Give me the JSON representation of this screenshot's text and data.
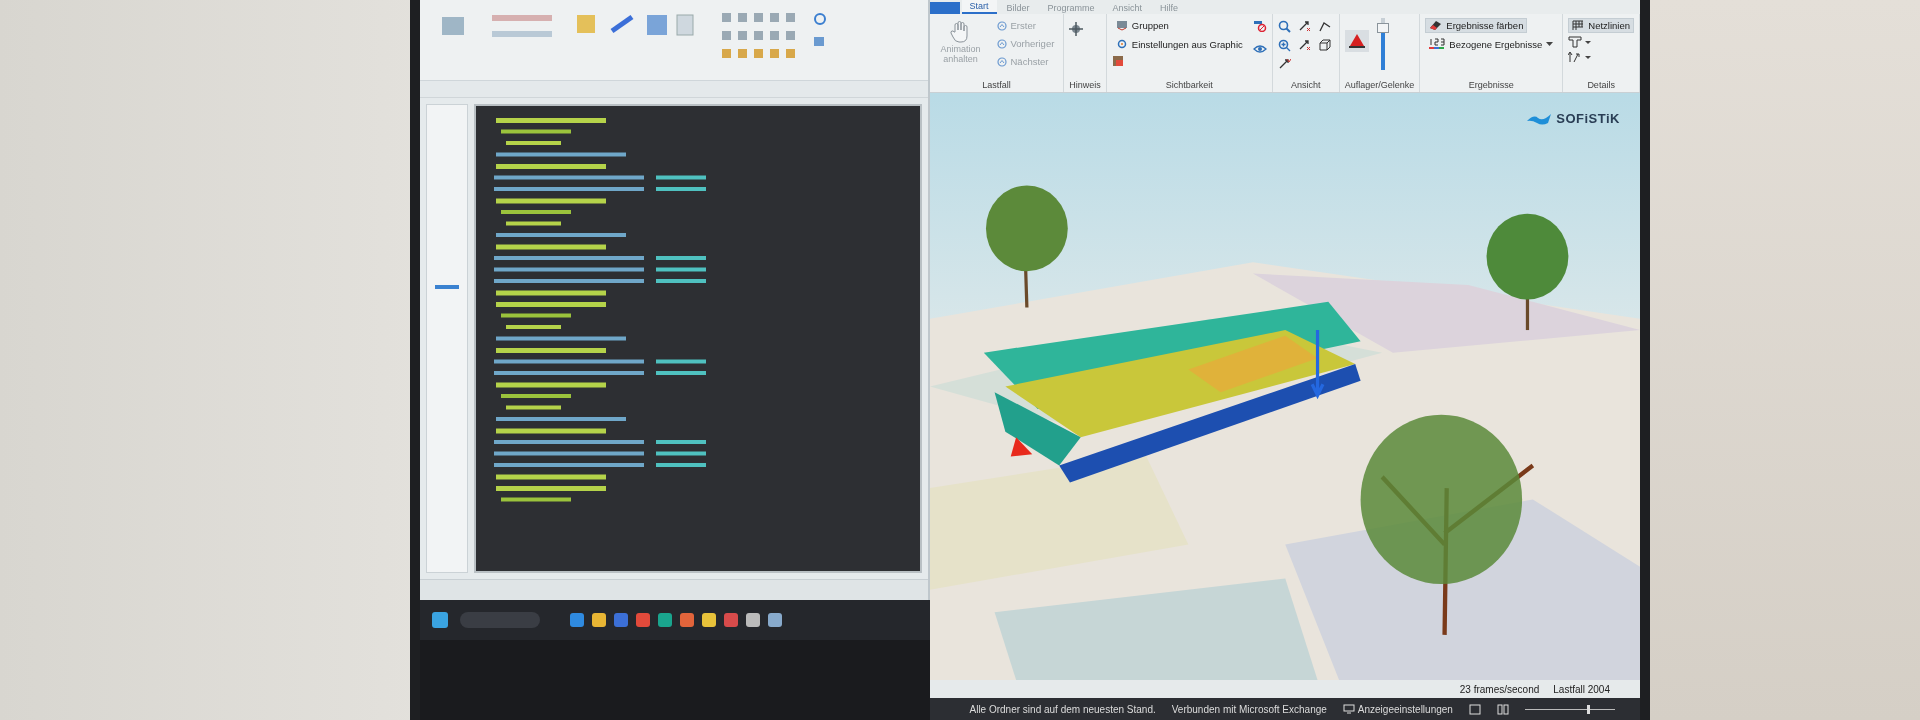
{
  "viewer": {
    "tabs": [
      {
        "label": "Start",
        "selected": true
      },
      {
        "label": "Bilder",
        "selected": false
      },
      {
        "label": "Programme",
        "selected": false
      },
      {
        "label": "Ansicht",
        "selected": false
      },
      {
        "label": "Hilfe",
        "selected": false
      }
    ],
    "groups": [
      {
        "title": "Lastfall",
        "kind": "lastfall",
        "large": {
          "label": "Animation anhalten",
          "disabled": true
        },
        "items": [
          {
            "label": "Erster",
            "disabled": true
          },
          {
            "label": "Vorheriger",
            "disabled": true
          },
          {
            "label": "Nächster",
            "disabled": true
          }
        ]
      },
      {
        "title": "Hinweis",
        "kind": "icon"
      },
      {
        "title": "Sichtbarkeit",
        "kind": "list",
        "items": [
          {
            "label": "Gruppen",
            "selected": false
          },
          {
            "label": "Einstellungen aus Graphic",
            "selected": false
          }
        ]
      },
      {
        "title": "Ansicht",
        "kind": "icons"
      },
      {
        "title": "Auflager/Gelenke",
        "kind": "slider",
        "level": 0.8
      },
      {
        "title": "Ergebnisse",
        "kind": "list",
        "items": [
          {
            "label": "Ergebnisse färben",
            "selected": true
          },
          {
            "label": "Bezogene Ergebnisse",
            "selected": false,
            "dropdown": true
          }
        ]
      },
      {
        "title": "Details",
        "kind": "details",
        "items": [
          {
            "label": "Netzlinien",
            "selected": true
          }
        ]
      }
    ],
    "logo": "SOFiSTiK",
    "status": {
      "fps": "23 frames/second",
      "load_case": "Lastfall 2004"
    }
  },
  "zoom": {
    "level": 0.7
  },
  "mail_status": [
    "Alle Ordner sind auf dem neuesten Stand.",
    "Verbunden mit Microsoft Exchange",
    "Anzeigeeinstellungen"
  ]
}
